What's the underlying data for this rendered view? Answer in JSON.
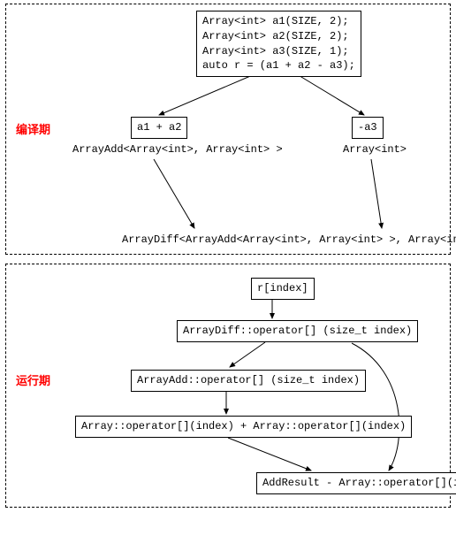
{
  "panels": {
    "compile": {
      "label": "编译期"
    },
    "runtime": {
      "label": "运行期"
    }
  },
  "compile": {
    "code": {
      "l1": "Array<int> a1(SIZE, 2);",
      "l2": "Array<int> a2(SIZE, 2);",
      "l3": "Array<int> a3(SIZE, 1);",
      "l4": "auto r = (a1 + a2 - a3);"
    },
    "left_box": "a1 + a2",
    "right_box": "-a3",
    "left_type": "ArrayAdd<Array<int>, Array<int> >",
    "right_type": "Array<int>",
    "bottom_type": "ArrayDiff<ArrayAdd<Array<int>, Array<int> >, Array<int> >"
  },
  "runtime": {
    "n1": "r[index]",
    "n2": "ArrayDiff::operator[] (size_t index)",
    "n3": "ArrayAdd::operator[] (size_t index)",
    "n4": "Array::operator[](index) + Array::operator[](index)",
    "n5": "AddResult - Array::operator[](index)"
  }
}
